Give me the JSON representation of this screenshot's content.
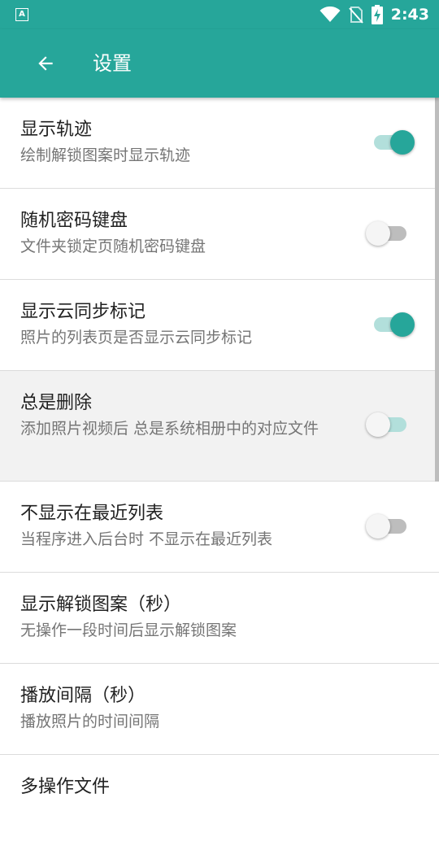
{
  "status_bar": {
    "left_icon_letter": "A",
    "time": "2:43",
    "icons": [
      "wifi-icon",
      "no-sim-icon",
      "battery-charging-icon"
    ]
  },
  "app_bar": {
    "back_icon": "arrow-left-icon",
    "title": "设置"
  },
  "colors": {
    "primary": "#26a69a",
    "switch_track_on": "#b2dfdb",
    "switch_track_off": "#bdbdbd"
  },
  "settings": [
    {
      "title": "显示轨迹",
      "summary": "绘制解锁图案时显示轨迹",
      "toggle": true
    },
    {
      "title": "随机密码键盘",
      "summary": "文件夹锁定页随机密码键盘",
      "toggle": false
    },
    {
      "title": "显示云同步标记",
      "summary": "照片的列表页是否显示云同步标记",
      "toggle": true
    },
    {
      "title": "总是删除",
      "summary": "添加照片视频后 总是系统相册中的对应文件",
      "toggle": false
    },
    {
      "title": "不显示在最近列表",
      "summary": "当程序进入后台时 不显示在最近列表",
      "toggle": false
    },
    {
      "title": "显示解锁图案（秒）",
      "summary": "无操作一段时间后显示解锁图案"
    },
    {
      "title": "播放间隔（秒）",
      "summary": "播放照片的时间间隔"
    },
    {
      "title": "多操作文件"
    }
  ]
}
